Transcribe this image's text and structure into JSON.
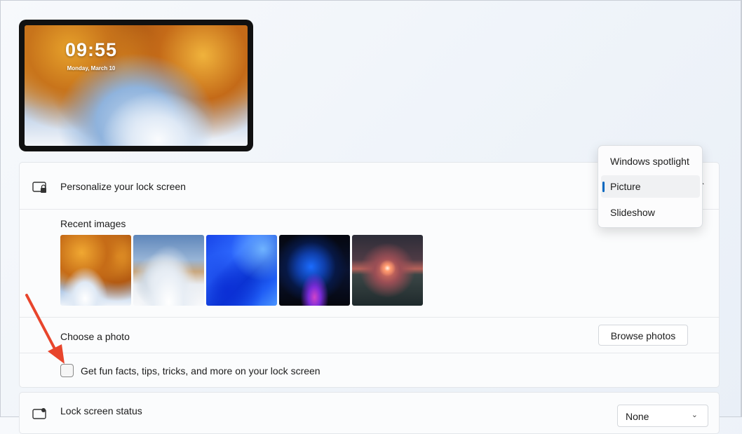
{
  "preview": {
    "time": "09:55",
    "date": "Monday, March 10"
  },
  "lock_screen_card": {
    "title": "Personalize your lock screen",
    "recent_images_label": "Recent images",
    "recent_images": [
      {
        "name": "autumn-leaves"
      },
      {
        "name": "snowy-trees"
      },
      {
        "name": "blue-abstract"
      },
      {
        "name": "bloom-dark"
      },
      {
        "name": "sunset-lake"
      }
    ],
    "choose_photo_label": "Choose a photo",
    "browse_button_label": "Browse photos",
    "fun_facts_label": "Get fun facts, tips, tricks, and more on your lock screen",
    "fun_facts_checked": false
  },
  "dropdown": {
    "options": [
      "Windows spotlight",
      "Picture",
      "Slideshow"
    ],
    "selected": "Picture"
  },
  "status_card": {
    "title": "Lock screen status",
    "select_value": "None"
  },
  "colors": {
    "accent": "#0067c0",
    "annotation_arrow": "#e8452c"
  },
  "icons": {
    "lock_screen": "lock-screen-icon",
    "status": "lock-status-icon",
    "chevron_up": "chevron-up-icon",
    "chevron_down": "chevron-down-icon"
  }
}
